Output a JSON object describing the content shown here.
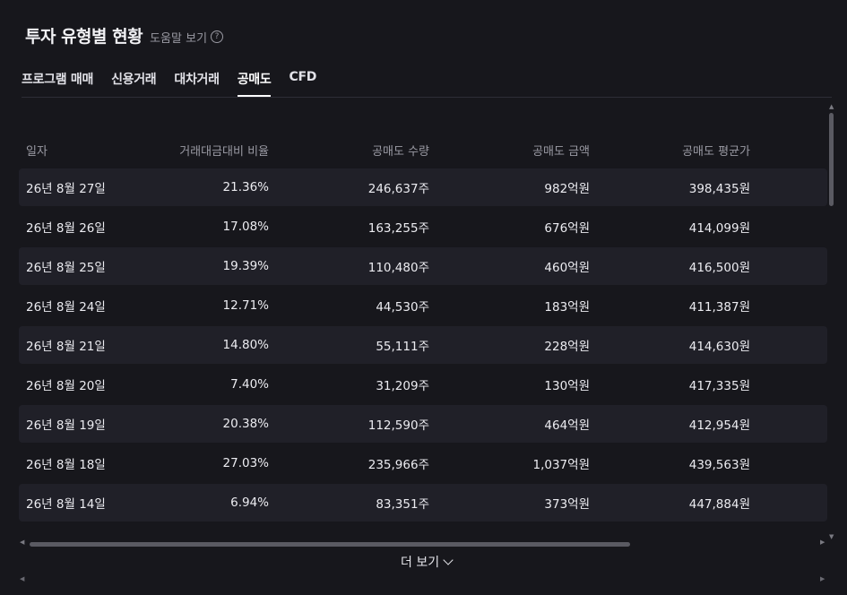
{
  "header": {
    "title": "투자 유형별 현황",
    "help_label": "도움말 보기",
    "help_icon": "?"
  },
  "tabs": [
    {
      "label": "프로그램 매매"
    },
    {
      "label": "신용거래"
    },
    {
      "label": "대차거래"
    },
    {
      "label": "공매도",
      "active": true
    },
    {
      "label": "CFD"
    }
  ],
  "table": {
    "columns": [
      "일자",
      "거래대금대비 비율",
      "공매도 수량",
      "공매도 금액",
      "공매도 평균가"
    ],
    "rows": [
      [
        "26년 8월 27일",
        "21.36%",
        "246,637주",
        "982억원",
        "398,435원"
      ],
      [
        "26년 8월 26일",
        "17.08%",
        "163,255주",
        "676억원",
        "414,099원"
      ],
      [
        "26년 8월 25일",
        "19.39%",
        "110,480주",
        "460억원",
        "416,500원"
      ],
      [
        "26년 8월 24일",
        "12.71%",
        "44,530주",
        "183억원",
        "411,387원"
      ],
      [
        "26년 8월 21일",
        "14.80%",
        "55,111주",
        "228억원",
        "414,630원"
      ],
      [
        "26년 8월 20일",
        "7.40%",
        "31,209주",
        "130억원",
        "417,335원"
      ],
      [
        "26년 8월 19일",
        "20.38%",
        "112,590주",
        "464억원",
        "412,954원"
      ],
      [
        "26년 8월 18일",
        "27.03%",
        "235,966주",
        "1,037억원",
        "439,563원"
      ],
      [
        "26년 8월 14일",
        "6.94%",
        "83,351주",
        "373억원",
        "447,884원"
      ]
    ]
  },
  "more_button": {
    "label": "더 보기"
  },
  "colors": {
    "background": "#17171c",
    "row_alt": "#202028",
    "muted_text": "#9a9aa3"
  },
  "icons": {
    "more": "chevron-down-icon",
    "help": "question-circle-icon"
  }
}
